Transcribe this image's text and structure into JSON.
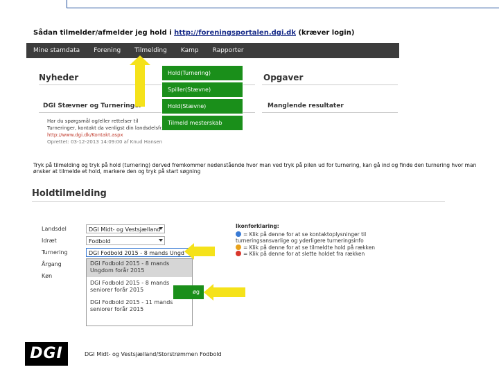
{
  "heading": {
    "prefix": "Sådan tilmelder/afmelder jeg hold i ",
    "link": "http://foreningsportalen.dgi.dk",
    "suffix": " (kræver login)"
  },
  "portal": {
    "nav": [
      "Mine stamdata",
      "Forening",
      "Tilmelding",
      "Kamp",
      "Rapporter"
    ],
    "news_title": "Nyheder",
    "tasks_title": "Opgaver",
    "news_sub": "DGI Stævner og Turneringer",
    "tasks_sub": "Manglende resultater",
    "news_body": [
      "Har du spørgsmål og/eller rettelser til",
      "Turneringer, kontakt da venligst din landsdelsforening her:"
    ],
    "news_link": "http://www.dgi.dk/Kontakt.aspx",
    "news_meta": "Oprettet: 03-12-2013 14:09:00 af Knud Hansen",
    "menu": [
      "Hold(Turnering)",
      "Spiller(Stævne)",
      "Hold(Stævne)",
      "Tilmeld mesterskab"
    ]
  },
  "instructions": "Tryk på tilmelding og tryk på hold (turnering) derved fremkommer nedenstående hvor man ved tryk på pilen ud for turnering, kan gå ind og finde den turnering hvor man ønsker at tilmelde et hold, markere den og tryk på start søgning",
  "form": {
    "title": "Holdtilmelding",
    "labels": [
      "Landsdel",
      "Idræt",
      "Turnering",
      "Årgang",
      "Køn"
    ],
    "landsdel_value": "DGI Midt- og Vestsjælland",
    "idraet_value": "Fodbold",
    "turnering_value": "DGI Fodbold 2015 - 8 mands Ungd",
    "options": [
      "DGI Fodbold 2015 - 8 mands",
      "Ungdom forår 2015",
      "DGI Fodbold 2015 - 8 mands",
      "seniorer forår 2015",
      "DGI Fodbold 2015 - 11 mands",
      "seniorer forår 2015"
    ],
    "button_label": "øg"
  },
  "legend": {
    "title": "Ikonforklaring:",
    "lines": [
      "= Klik på denne for at se kontaktoplysninger til turneringsansvarlige og yderligere turneringsinfo",
      "= Klik på denne for at se tilmeldte hold på rækken",
      "= Klik på denne for at slette holdet fra rækken"
    ]
  },
  "footer": {
    "logo": "DGI",
    "text": "DGI Midt- og Vestsjælland/Storstrømmen Fodbold"
  },
  "colors": {
    "menu_green": "#1a8f1a",
    "arrow_yellow": "#f5e21a",
    "nav_dark": "#3c3c3c",
    "link_blue": "#1a2e8a"
  }
}
